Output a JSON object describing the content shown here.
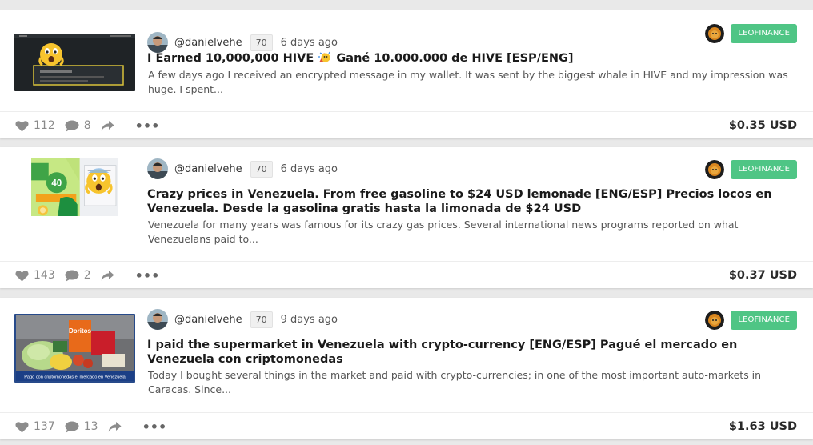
{
  "posts": [
    {
      "thumbnail": "screenshot-wallet-shocked-emoji",
      "author": "@danielvehe",
      "reputation": "70",
      "time": "6 days ago",
      "community": "LEOFINANCE",
      "title_before": "I Earned 10,000,000 HIVE ",
      "title_after": " Gané 10.000.000 de HIVE [ESP/ENG]",
      "title_emoji": "party-face-emoji",
      "excerpt": "A few days ago I received an encrypted message in my wallet. It was sent by the biggest whale in HIVE and my impression was huge. I spent...",
      "votes": "112",
      "comments": "8",
      "payout": "$0.35 USD"
    },
    {
      "thumbnail": "lemonade-package-shocked-emoji",
      "author": "@danielvehe",
      "reputation": "70",
      "time": "6 days ago",
      "community": "LEOFINANCE",
      "title_before": "Crazy prices in Venezuela. From free gasoline to $24 USD lemonade [ENG/ESP] Precios locos en Venezuela. Desde la gasolina gratis hasta la limonada de $24 USD",
      "title_after": "",
      "title_emoji": "",
      "excerpt": "Venezuela for many years was famous for its crazy gas prices. Several international news programs reported on what Venezuelans paid to...",
      "votes": "143",
      "comments": "2",
      "payout": "$0.37 USD"
    },
    {
      "thumbnail": "groceries-photo",
      "thumbnail_caption": "Pago con criptomonedas el mercado en Venezuela",
      "author": "@danielvehe",
      "reputation": "70",
      "time": "9 days ago",
      "community": "LEOFINANCE",
      "title_before": "I paid the supermarket in Venezuela with crypto-currency [ENG/ESP] Pagué el mercado en Venezuela con criptomonedas",
      "title_after": "",
      "title_emoji": "",
      "excerpt": "Today I bought several things in the market and paid with crypto-currencies; in one of the most important auto-markets in Caracas. Since...",
      "votes": "137",
      "comments": "13",
      "payout": "$1.63 USD"
    }
  ],
  "colors": {
    "tag_bg": "#4fc585",
    "icon_gray": "#888888",
    "page_bg": "#e9e9e9"
  }
}
